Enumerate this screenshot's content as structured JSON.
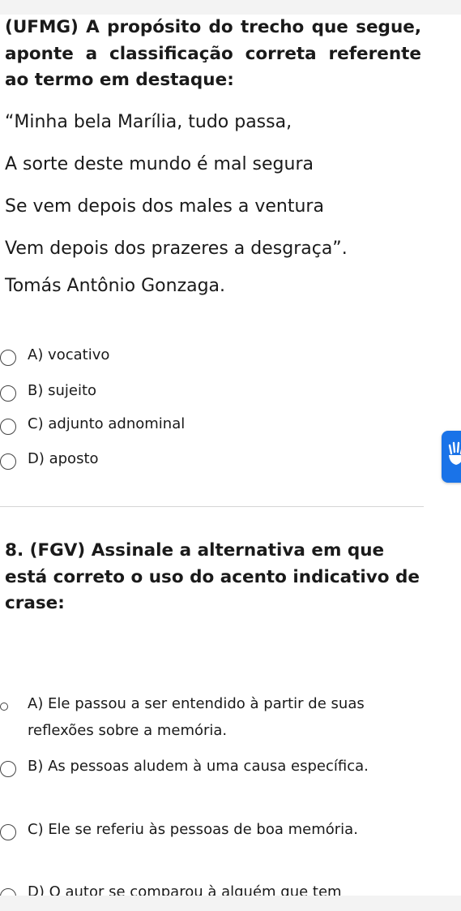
{
  "question1": {
    "heading": "(UFMG) A propósito do trecho que segue, aponte a classificação correta referente ao termo em destaque:",
    "quote_lines": [
      "“Minha bela Marília, tudo passa,",
      "A sorte deste mundo é mal segura",
      "Se vem depois dos males a ventura",
      "Vem depois dos prazeres a desgraça”."
    ],
    "author": "Tomás Antônio Gonzaga.",
    "options": [
      "A) vocativo",
      "B) sujeito",
      "C) adjunto adnominal",
      "D) aposto"
    ]
  },
  "question2": {
    "heading": "8. (FGV) Assinale a alternativa em que está correto o uso do acento indicativo de crase:",
    "options": [
      "A) Ele passou a ser entendido à partir de suas reflexões sobre a memória.",
      "B) As pessoas aludem à uma causa específica.",
      "C) Ele se referiu às pessoas de boa memória.",
      "D) O autor se comparou à alguém que tem"
    ]
  },
  "side_button": {
    "icon": "hand-wave-icon",
    "color": "#1a73e8"
  }
}
